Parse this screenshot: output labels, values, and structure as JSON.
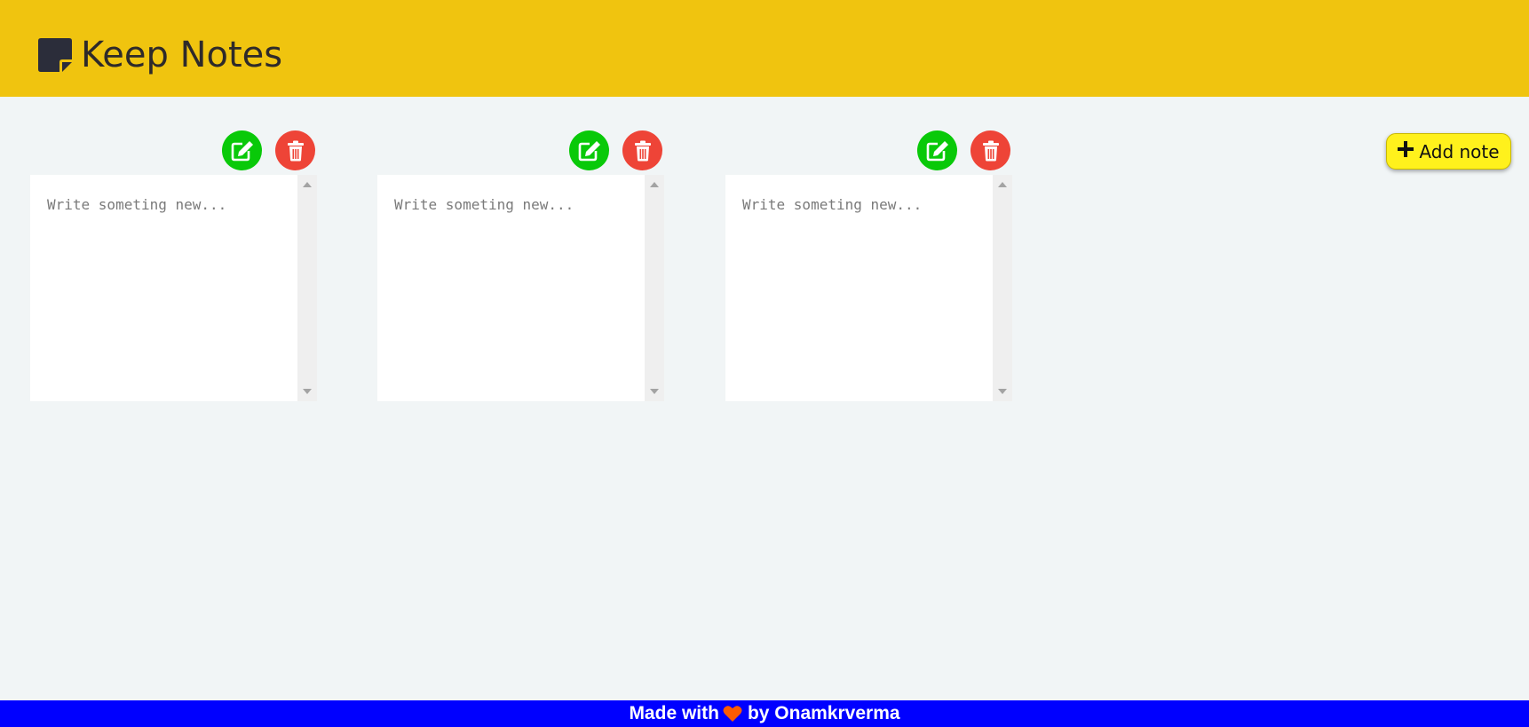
{
  "app": {
    "title": "Keep Notes",
    "logo_icon": "sticky-note-icon"
  },
  "colors": {
    "header_bg": "#f0c40f",
    "page_bg": "#f1f5f6",
    "edit_button": "#09c909",
    "delete_button": "#ee4437",
    "add_button": "#fff11c",
    "footer_bg": "#0000ff",
    "heart": "#ff5b00"
  },
  "notes": [
    {
      "value": "",
      "placeholder": "Write someting new...",
      "edit_icon": "edit-icon",
      "delete_icon": "trash-icon"
    },
    {
      "value": "",
      "placeholder": "Write someting new...",
      "edit_icon": "edit-icon",
      "delete_icon": "trash-icon"
    },
    {
      "value": "",
      "placeholder": "Write someting new...",
      "edit_icon": "edit-icon",
      "delete_icon": "trash-icon"
    }
  ],
  "add_button": {
    "icon": "plus-icon",
    "label": "Add note"
  },
  "footer": {
    "prefix": "Made with",
    "icon": "heart-icon",
    "suffix": "by Onamkrverma"
  }
}
